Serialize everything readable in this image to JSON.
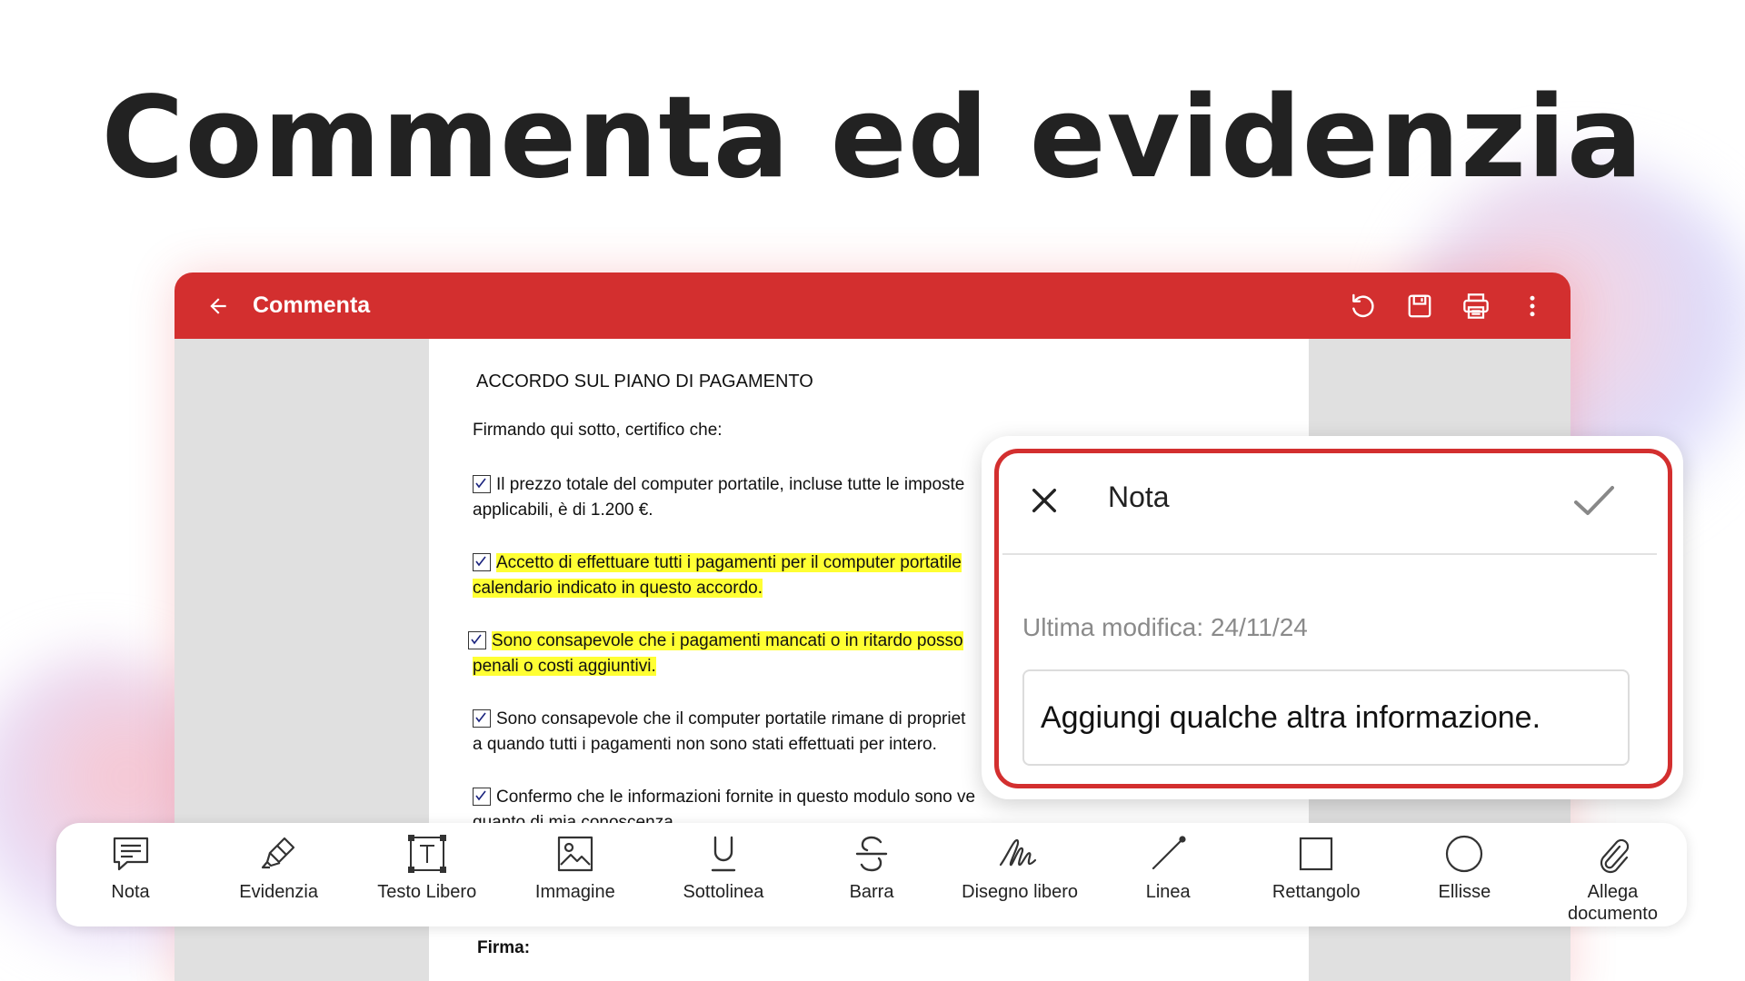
{
  "headline": "Commenta ed evidenzia",
  "app": {
    "title": "Commenta",
    "icons": [
      "back-arrow-icon",
      "undo-icon",
      "save-icon",
      "print-icon",
      "more-vert-icon"
    ]
  },
  "document": {
    "title": "ACCORDO SUL PIANO DI PAGAMENTO",
    "intro": "Firmando qui sotto, certifico che:",
    "clauses": [
      {
        "line1": "Il prezzo totale del computer portatile, incluse tutte le imposte",
        "line2": "applicabili, è di 1.200 €.",
        "highlighted": false,
        "checked": true
      },
      {
        "line1": "Accetto di effettuare tutti i pagamenti per il computer portatile",
        "line2": "calendario indicato in questo accordo.",
        "highlighted": true,
        "checked": true
      },
      {
        "line1": "Sono consapevole che i pagamenti mancati o in ritardo posso",
        "line2": "penali o costi aggiuntivi.",
        "highlighted": true,
        "checked": true
      },
      {
        "line1": "Sono consapevole che il computer portatile rimane di propriet",
        "line2": "a quando tutti i pagamenti non sono stati effettuati per intero.",
        "highlighted": false,
        "checked": true
      },
      {
        "line1": "Confermo che le informazioni fornite in questo modulo sono ve",
        "line2": "quanto di mia conoscenza",
        "highlighted": false,
        "checked": true
      }
    ],
    "signature_label": "Firma:",
    "highlight_color": "#ffff33"
  },
  "note_dialog": {
    "title": "Nota",
    "last_modified": "Ultima modifica: 24/11/24",
    "text_value": "Aggiungi qualche altra informazione.",
    "border_color": "#d32f2f"
  },
  "toolbar": {
    "tools": [
      {
        "label": "Nota",
        "icon": "note-icon"
      },
      {
        "label": "Evidenzia",
        "icon": "highlighter-icon"
      },
      {
        "label": "Testo Libero",
        "icon": "text-box-icon"
      },
      {
        "label": "Immagine",
        "icon": "image-icon"
      },
      {
        "label": "Sottolinea",
        "icon": "underline-icon"
      },
      {
        "label": "Barra",
        "icon": "strikethrough-icon"
      },
      {
        "label": "Disegno libero",
        "icon": "freehand-icon"
      },
      {
        "label": "Linea",
        "icon": "line-icon"
      },
      {
        "label": "Rettangolo",
        "icon": "rectangle-icon"
      },
      {
        "label": "Ellisse",
        "icon": "ellipse-icon"
      },
      {
        "label": "Allega documento",
        "icon": "paperclip-icon"
      }
    ]
  },
  "colors": {
    "brand": "#d32f2f",
    "headline": "#222222"
  }
}
